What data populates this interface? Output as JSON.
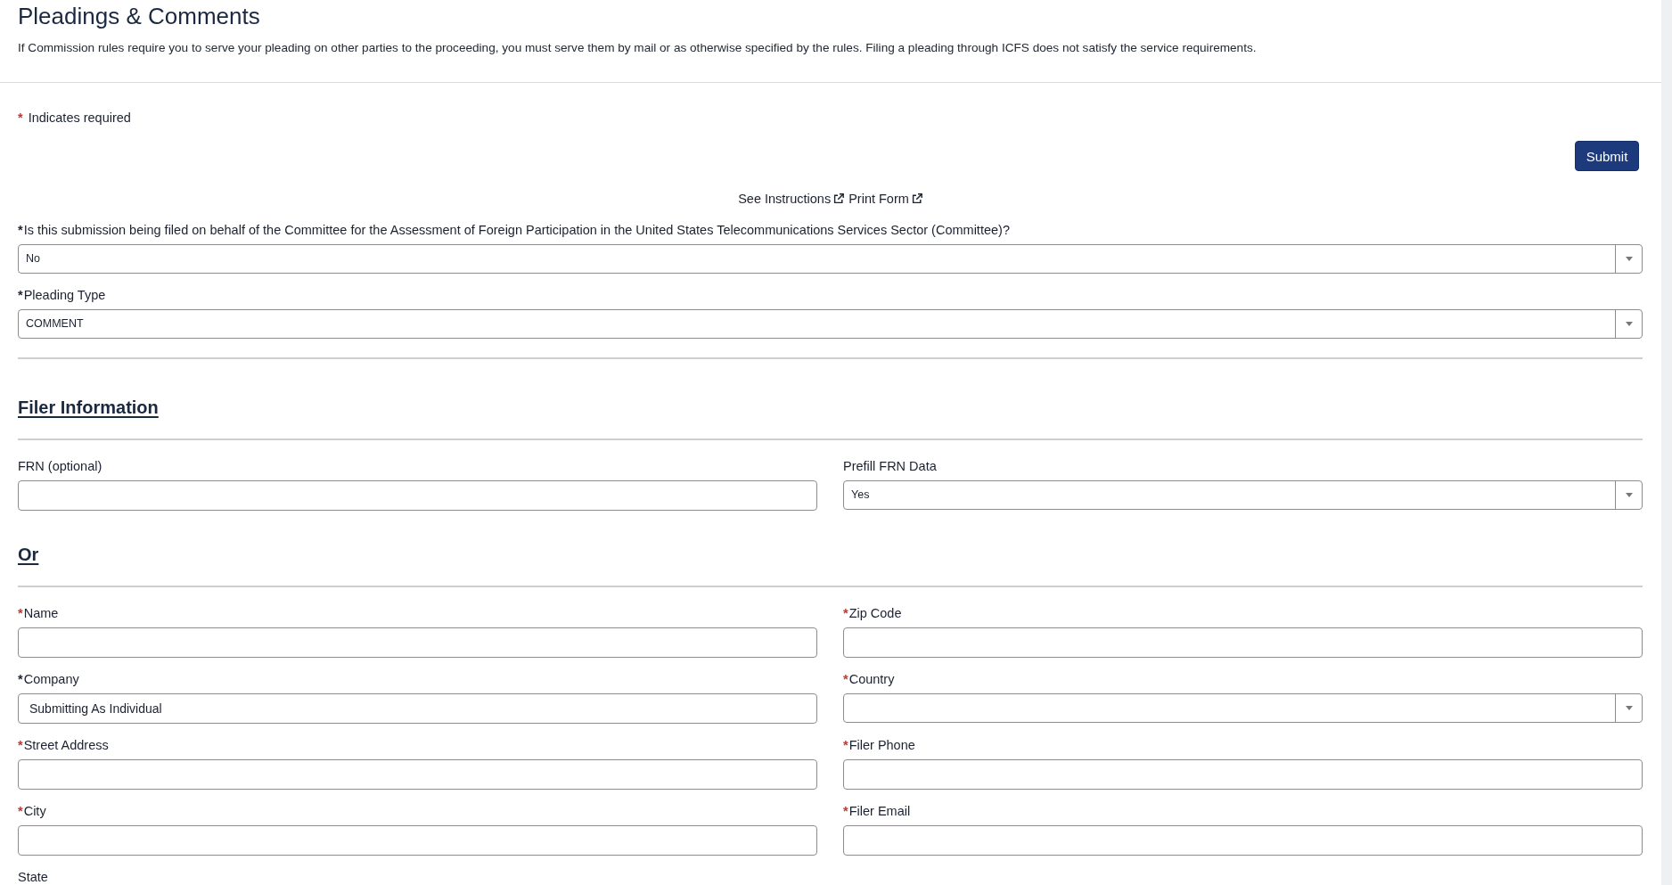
{
  "header": {
    "title": "Pleadings & Comments",
    "notice": "If Commission rules require you to serve your pleading on other parties to the proceeding, you must serve them by mail or as otherwise specified by the rules. Filing a pleading through ICFS does not satisfy the service requirements."
  },
  "required_legend": {
    "mark": "*",
    "text": "Indicates required"
  },
  "submit_button": {
    "label": "Submit"
  },
  "links": [
    {
      "label": "See Instructions"
    },
    {
      "label": "Print Form"
    }
  ],
  "filing_fields": [
    {
      "kind": "select",
      "mark": {
        "text": "*",
        "color": "#1f2430"
      },
      "label": "Is this submission being filed on behalf of the Committee for the Assessment of Foreign Participation in the United States Telecommunications Services Sector (Committee)?",
      "value": "No"
    },
    {
      "kind": "select",
      "mark": {
        "text": "*",
        "color": "#1f2430"
      },
      "label": "Pleading Type",
      "value": "COMMENT"
    }
  ],
  "sections": [
    {
      "heading": "Filer Information",
      "fields": [
        {
          "kind": "text",
          "label": "FRN (optional)"
        },
        {
          "kind": "select",
          "label": "Prefill FRN Data",
          "value": "Yes"
        }
      ]
    },
    {
      "heading": "Or",
      "fields": [
        {
          "kind": "text",
          "mark": {
            "text": "*",
            "color": "#d0312d"
          },
          "label": "Name"
        },
        {
          "kind": "text",
          "mark": {
            "text": "*",
            "color": "#d0312d"
          },
          "label": "Zip Code"
        },
        {
          "kind": "text",
          "mark": {
            "text": "*",
            "color": "#1f2430"
          },
          "label": "Company",
          "value": "Submitting As Individual"
        },
        {
          "kind": "select",
          "mark": {
            "text": "*",
            "color": "#d0312d"
          },
          "label": "Country"
        },
        {
          "kind": "text",
          "mark": {
            "text": "*",
            "color": "#d0312d"
          },
          "label": "Street Address"
        },
        {
          "kind": "text",
          "mark": {
            "text": "*",
            "color": "#d0312d"
          },
          "label": "Filer Phone"
        },
        {
          "kind": "text",
          "mark": {
            "text": "*",
            "color": "#d0312d"
          },
          "label": "City"
        },
        {
          "kind": "text",
          "mark": {
            "text": "*",
            "color": "#d0312d"
          },
          "label": "Filer Email"
        },
        {
          "kind": "label_only",
          "label": "State"
        }
      ]
    }
  ]
}
